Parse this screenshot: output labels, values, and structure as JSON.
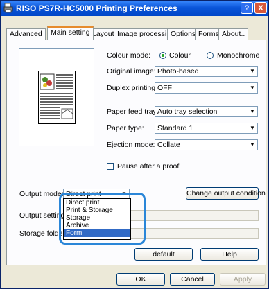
{
  "window": {
    "title": "RISO PS7R-HC5000 Printing Preferences",
    "help": "?",
    "close": "X"
  },
  "tabs": [
    "Advanced",
    "Main setting",
    "Layout",
    "Image processing",
    "Options",
    "Forms",
    "About.."
  ],
  "colour_mode": {
    "label": "Colour mode:",
    "opt_colour": "Colour",
    "opt_mono": "Monochrome",
    "selected": "Colour"
  },
  "original_image": {
    "label": "Original image:",
    "value": "Photo-based"
  },
  "duplex": {
    "label": "Duplex printing:",
    "value": "OFF"
  },
  "paper_feed": {
    "label": "Paper feed tray:",
    "value": "Auto tray selection"
  },
  "paper_type": {
    "label": "Paper type:",
    "value": "Standard 1"
  },
  "ejection": {
    "label": "Ejection mode:",
    "value": "Collate"
  },
  "pause": {
    "label": "Pause after a proof"
  },
  "output_mode": {
    "label": "Output mode:",
    "value": "Direct print",
    "options": [
      "Direct print",
      "Print & Storage",
      "Storage",
      "Archive",
      "Form"
    ],
    "highlighted": "Form"
  },
  "change_output": "Change output condition",
  "output_setting": {
    "label": "Output setting"
  },
  "storage_folder": {
    "label": "Storage folde"
  },
  "buttons": {
    "default": "default",
    "help": "Help",
    "ok": "OK",
    "cancel": "Cancel",
    "apply": "Apply"
  }
}
